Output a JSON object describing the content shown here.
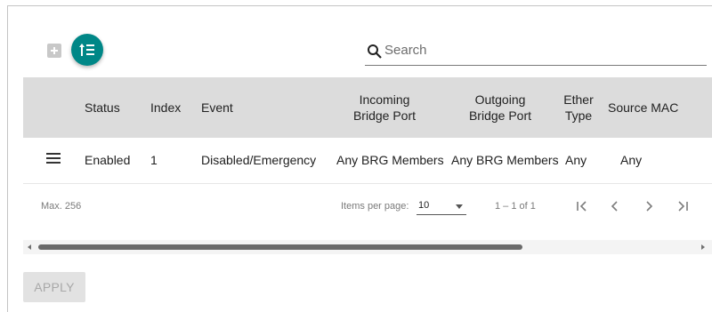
{
  "toolbar": {
    "add_icon": "plus-icon",
    "sort_icon": "sort-list-icon",
    "accent_color": "#008787",
    "search": {
      "placeholder": "Search",
      "value": ""
    }
  },
  "table": {
    "columns": [
      {
        "label": "Status"
      },
      {
        "label": "Index"
      },
      {
        "label": "Event"
      },
      {
        "line1": "Incoming",
        "line2": "Bridge Port"
      },
      {
        "line1": "Outgoing",
        "line2": "Bridge Port"
      },
      {
        "line1": "Ether",
        "line2": "Type"
      },
      {
        "label": "Source MAC"
      }
    ],
    "rows": [
      {
        "status": "Enabled",
        "index": "1",
        "event": "Disabled/Emergency",
        "incoming": "Any BRG Members",
        "outgoing": "Any BRG Members",
        "ether_type": "Any",
        "source_mac": "Any"
      }
    ],
    "header_bg": "#dcdcdc"
  },
  "paginator": {
    "max": "Max. 256",
    "items_per_page_label": "Items per page:",
    "page_size": "10",
    "range": "1 – 1 of 1"
  },
  "footer": {
    "apply_label": "APPLY"
  }
}
